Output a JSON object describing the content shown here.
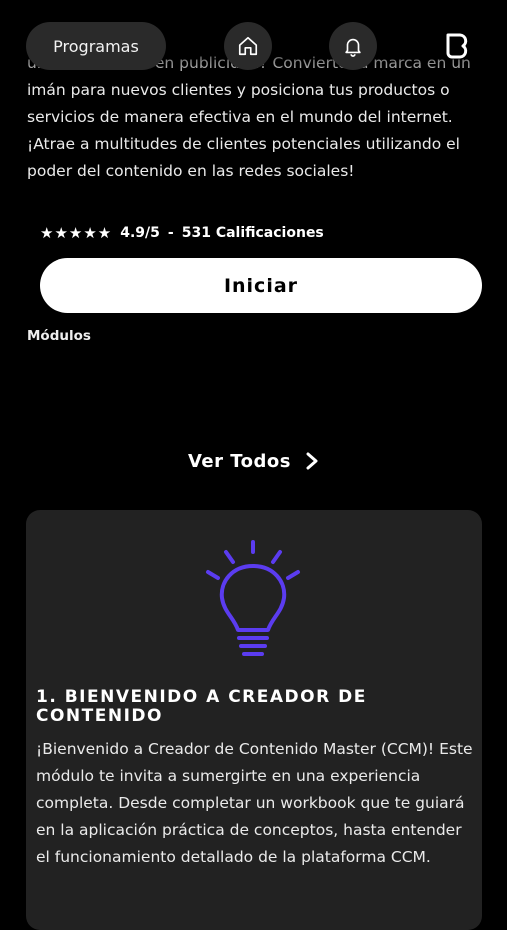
{
  "hero": {
    "description": "un solo centavo en publicidad? Convierte tu marca en un\nimán para nuevos clientes y posiciona tus productos o\nservicios de manera efectiva en el mundo del internet.\n¡Atrae a multitudes de clientes potenciales utilizando el\npoder del contenido en las redes sociales!"
  },
  "nav": {
    "programs_label": "Programas",
    "home_icon": "home-icon",
    "bell_icon": "bell-icon",
    "logo_icon": "brand-logo-icon"
  },
  "rating": {
    "stars": "★★★★★",
    "score": "4.9/5",
    "separator": "-",
    "count": "531 Calificaciones"
  },
  "actions": {
    "start_label": "Iniciar"
  },
  "modules": {
    "section_label": "Módulos",
    "see_all_label": "Ver Todos",
    "items": [
      {
        "title": "1. Bienvenido a Creador de Contenido",
        "description": "¡Bienvenido a Creador de Contenido Master (CCM)! Este módulo te invita a sumergirte en una experiencia completa. Desde completar un workbook que te guiará en la aplicación práctica de conceptos, hasta entender el funcionamiento detallado de la plataforma CCM.",
        "icon": "lightbulb-icon"
      }
    ]
  },
  "colors": {
    "background": "#000000",
    "surface": "#2a2a2a",
    "card": "#222222",
    "accent": "#5b3cf0",
    "button": "#ffffff"
  }
}
